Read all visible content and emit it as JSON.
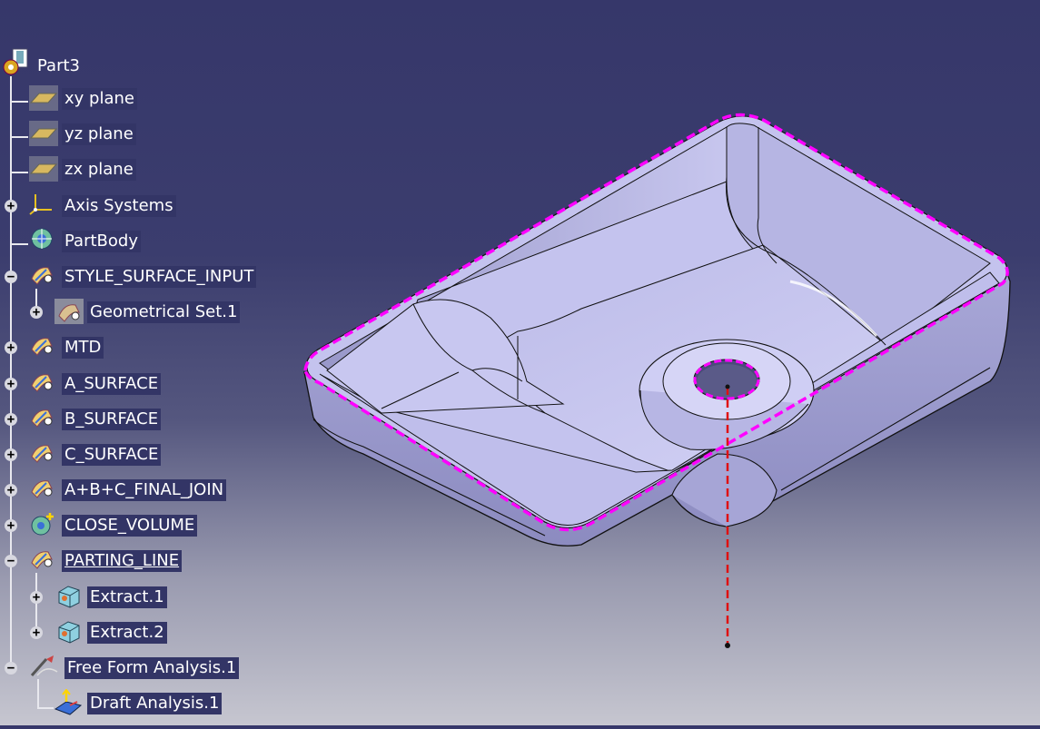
{
  "tree": {
    "root": {
      "label": "Part3",
      "icon": "part-icon"
    },
    "items": [
      {
        "label": "xy plane",
        "icon": "plane-icon",
        "expander": ""
      },
      {
        "label": "yz plane",
        "icon": "plane-icon",
        "expander": ""
      },
      {
        "label": "zx plane",
        "icon": "plane-icon",
        "expander": ""
      },
      {
        "label": "Axis Systems",
        "icon": "axis-system-icon",
        "expander": "+"
      },
      {
        "label": "PartBody",
        "icon": "part-body-icon",
        "expander": ""
      },
      {
        "label": "STYLE_SURFACE_INPUT",
        "icon": "geometrical-set-icon",
        "expander": "−"
      },
      {
        "label": "Geometrical Set.1",
        "icon": "geometrical-set-child-icon",
        "expander": "+"
      },
      {
        "label": "MTD",
        "icon": "geometrical-set-icon",
        "expander": "+"
      },
      {
        "label": "A_SURFACE",
        "icon": "geometrical-set-icon",
        "expander": "+"
      },
      {
        "label": "B_SURFACE",
        "icon": "geometrical-set-icon",
        "expander": "+"
      },
      {
        "label": "C_SURFACE",
        "icon": "geometrical-set-icon",
        "expander": "+"
      },
      {
        "label": "A+B+C_FINAL_JOIN",
        "icon": "geometrical-set-icon",
        "expander": "+"
      },
      {
        "label": "CLOSE_VOLUME",
        "icon": "close-volume-icon",
        "expander": "+"
      },
      {
        "label": "PARTING_LINE",
        "icon": "geometrical-set-icon",
        "expander": "−"
      },
      {
        "label": "Extract.1",
        "icon": "extract-icon",
        "expander": "+"
      },
      {
        "label": "Extract.2",
        "icon": "extract-icon",
        "expander": "+"
      },
      {
        "label": "Free Form Analysis.1",
        "icon": "free-form-analysis-icon",
        "expander": "−"
      },
      {
        "label": "Draft Analysis.1",
        "icon": "draft-analysis-icon",
        "expander": ""
      }
    ]
  },
  "viewport": {
    "model": "tray-part-3d-model",
    "parting_line_color": "#ff00ff",
    "pull_direction_color": "#e01010",
    "surface_color": "#c9c8f0"
  }
}
